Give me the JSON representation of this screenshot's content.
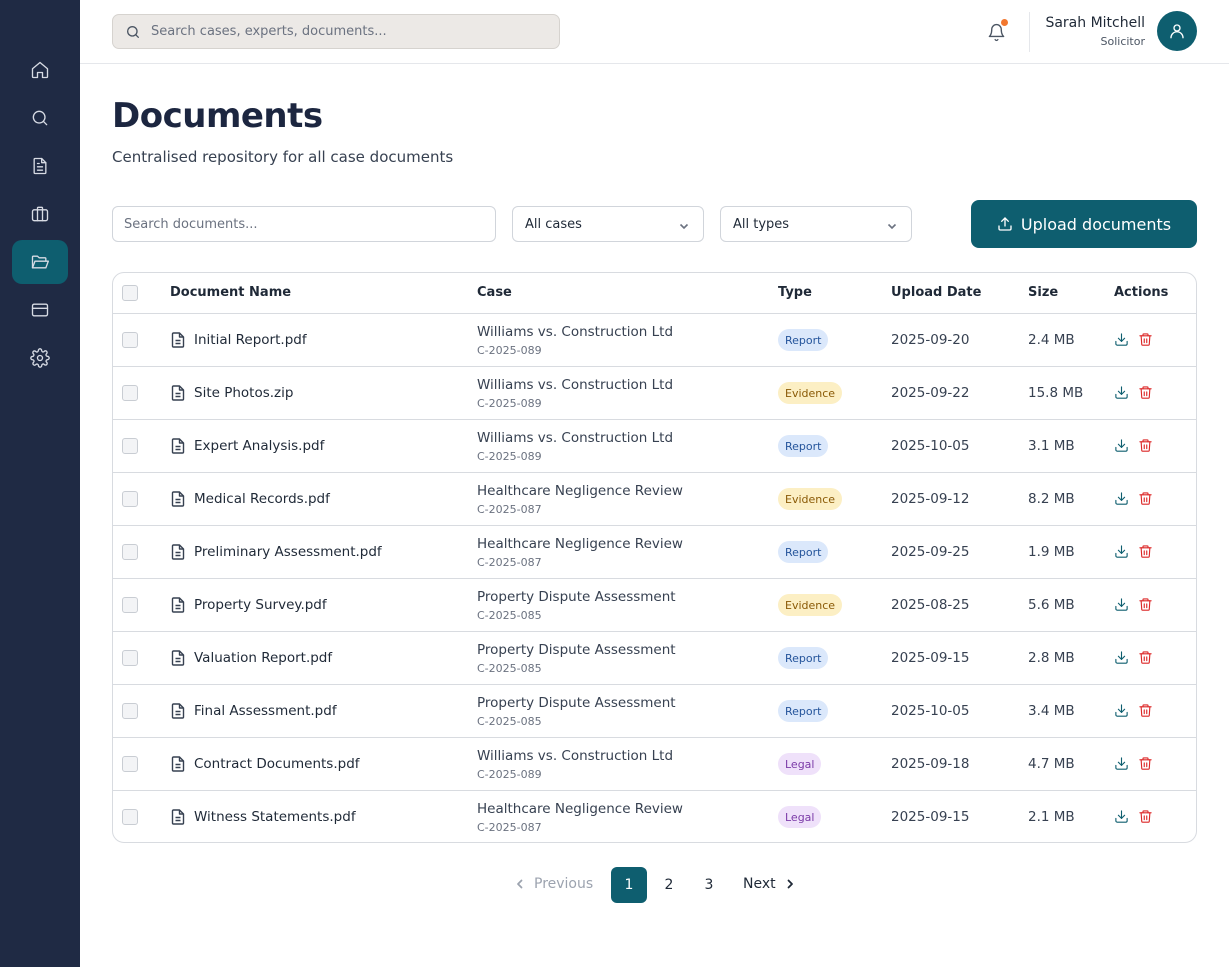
{
  "sidebar": {
    "items": [
      {
        "icon": "home-icon",
        "active": false
      },
      {
        "icon": "search-icon",
        "active": false
      },
      {
        "icon": "document-icon",
        "active": false
      },
      {
        "icon": "briefcase-icon",
        "active": false
      },
      {
        "icon": "folder-open-icon",
        "active": true
      },
      {
        "icon": "credit-card-icon",
        "active": false
      },
      {
        "icon": "gear-icon",
        "active": false
      }
    ]
  },
  "topbar": {
    "search_placeholder": "Search cases, experts, documents...",
    "notification_dot_color": "#f2772e",
    "user": {
      "name": "Sarah Mitchell",
      "role": "Solicitor"
    }
  },
  "page": {
    "title": "Documents",
    "subtitle": "Centralised repository for all case documents"
  },
  "filters": {
    "search_placeholder": "Search documents...",
    "case_select": "All cases",
    "type_select": "All types",
    "upload_label": "Upload documents"
  },
  "table": {
    "columns": [
      "Document Name",
      "Case",
      "Type",
      "Upload Date",
      "Size",
      "Actions"
    ],
    "rows": [
      {
        "name": "Initial Report.pdf",
        "case": "Williams vs. Construction Ltd",
        "case_id": "C-2025-089",
        "type": "Report",
        "date": "2025-09-20",
        "size": "2.4 MB"
      },
      {
        "name": "Site Photos.zip",
        "case": "Williams vs. Construction Ltd",
        "case_id": "C-2025-089",
        "type": "Evidence",
        "date": "2025-09-22",
        "size": "15.8 MB"
      },
      {
        "name": "Expert Analysis.pdf",
        "case": "Williams vs. Construction Ltd",
        "case_id": "C-2025-089",
        "type": "Report",
        "date": "2025-10-05",
        "size": "3.1 MB"
      },
      {
        "name": "Medical Records.pdf",
        "case": "Healthcare Negligence Review",
        "case_id": "C-2025-087",
        "type": "Evidence",
        "date": "2025-09-12",
        "size": "8.2 MB"
      },
      {
        "name": "Preliminary Assessment.pdf",
        "case": "Healthcare Negligence Review",
        "case_id": "C-2025-087",
        "type": "Report",
        "date": "2025-09-25",
        "size": "1.9 MB"
      },
      {
        "name": "Property Survey.pdf",
        "case": "Property Dispute Assessment",
        "case_id": "C-2025-085",
        "type": "Evidence",
        "date": "2025-08-25",
        "size": "5.6 MB"
      },
      {
        "name": "Valuation Report.pdf",
        "case": "Property Dispute Assessment",
        "case_id": "C-2025-085",
        "type": "Report",
        "date": "2025-09-15",
        "size": "2.8 MB"
      },
      {
        "name": "Final Assessment.pdf",
        "case": "Property Dispute Assessment",
        "case_id": "C-2025-085",
        "type": "Report",
        "date": "2025-10-05",
        "size": "3.4 MB"
      },
      {
        "name": "Contract Documents.pdf",
        "case": "Williams vs. Construction Ltd",
        "case_id": "C-2025-089",
        "type": "Legal",
        "date": "2025-09-18",
        "size": "4.7 MB"
      },
      {
        "name": "Witness Statements.pdf",
        "case": "Healthcare Negligence Review",
        "case_id": "C-2025-087",
        "type": "Legal",
        "date": "2025-09-15",
        "size": "2.1 MB"
      }
    ]
  },
  "pagination": {
    "previous": "Previous",
    "pages": [
      "1",
      "2",
      "3"
    ],
    "current": "1",
    "next": "Next"
  },
  "colors": {
    "sidebar": "#1f2a44",
    "accent": "#0e5e6f",
    "delete": "#dc2626"
  }
}
